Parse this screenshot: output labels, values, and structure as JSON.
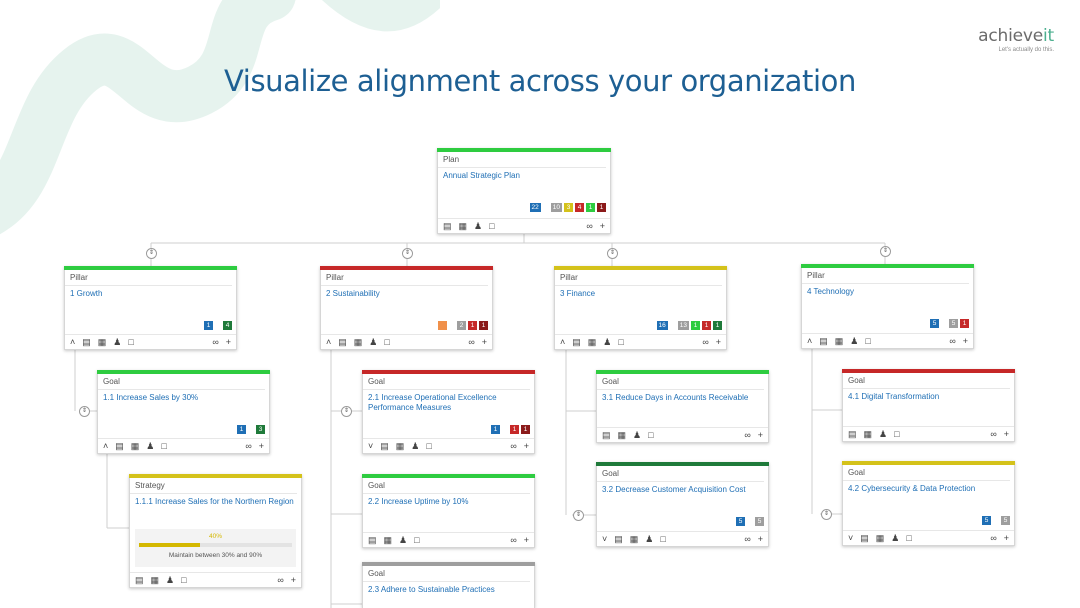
{
  "brand": {
    "logo_main": "achieve",
    "logo_accent": "it",
    "tagline": "Let's actually do this.",
    "accent": "#4caf8f"
  },
  "headline": "Visualize alignment across your organization",
  "colors": {
    "green": "#2ecc40",
    "red": "#c62828",
    "yellow": "#d4c21a",
    "darkgreen": "#1f7a3a",
    "gray": "#9e9e9e",
    "blue": "#1f6fb5",
    "orange": "#f0904a"
  },
  "plan": {
    "type": "Plan",
    "title": "Annual Strategic Plan",
    "badges": [
      "22",
      "10",
      "3",
      "4",
      "1",
      "1"
    ]
  },
  "pillars": [
    {
      "type": "Pillar",
      "title": "1 Growth",
      "badges": [
        "1",
        "4"
      ]
    },
    {
      "type": "Pillar",
      "title": "2 Sustainability",
      "badges": [
        "",
        "2",
        "1",
        "1"
      ]
    },
    {
      "type": "Pillar",
      "title": "3 Finance",
      "badges": [
        "16",
        "13",
        "1",
        "1",
        "1"
      ]
    },
    {
      "type": "Pillar",
      "title": "4 Technology",
      "badges": [
        "5",
        "5",
        "1"
      ]
    }
  ],
  "goals": [
    {
      "type": "Goal",
      "title": "1.1 Increase Sales by 30%",
      "badges": [
        "1",
        "3"
      ]
    },
    {
      "type": "Goal",
      "title": "2.1 Increase Operational Excellence Performance Measures",
      "badges": [
        "1",
        "1",
        "1"
      ]
    },
    {
      "type": "Goal",
      "title": "2.2 Increase Uptime by 10%",
      "badges": []
    },
    {
      "type": "Goal",
      "title": "2.3 Adhere to Sustainable Practices",
      "badges": []
    },
    {
      "type": "Goal",
      "title": "3.1 Reduce Days in Accounts Receivable",
      "badges": []
    },
    {
      "type": "Goal",
      "title": "3.2 Decrease Customer Acquisition Cost",
      "badges": [
        "5",
        "5"
      ]
    },
    {
      "type": "Goal",
      "title": "4.1 Digital Transformation",
      "badges": []
    },
    {
      "type": "Goal",
      "title": "4.2 Cybersecurity & Data Protection",
      "badges": [
        "5",
        "5"
      ]
    }
  ],
  "strategy": {
    "type": "Strategy",
    "title": "1.1.1 Increase Sales for the Northern Region",
    "progress_label": "40%",
    "progress_value": 0.4,
    "progress_note": "Maintain between 30% and 90%"
  }
}
